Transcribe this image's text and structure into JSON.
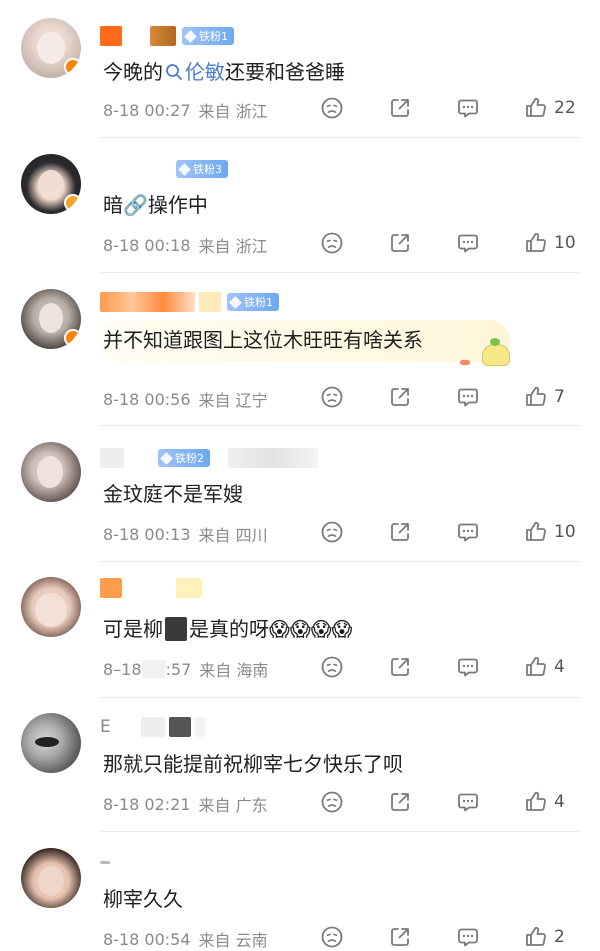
{
  "comments": [
    {
      "text_before": "今晚的",
      "topic": "伦敏",
      "text_after": "还要和爸爸睡",
      "fan_badge": "铁粉1",
      "date": "8-18 00:27",
      "location": "来自 浙江",
      "likes": "22"
    },
    {
      "text": "暗🔗操作中",
      "fan_badge": "铁粉3",
      "date": "8-18 00:18",
      "location": "来自 浙江",
      "likes": "10"
    },
    {
      "text": "并不知道跟图上这位木旺旺有啥关系",
      "fan_badge": "铁粉1",
      "date": "8-18 00:56",
      "location": "来自 辽宁",
      "likes": "7"
    },
    {
      "text": "金玟庭不是军嫂",
      "fan_badge": "铁粉2",
      "date": "8-18 00:13",
      "location": "来自 四川",
      "likes": "10"
    },
    {
      "text_before": "可是柳",
      "text_after": "是真的呀😱😱😱😱",
      "date_before": "8–18",
      "date_after": ":57",
      "location": "来自 海南",
      "likes": "4"
    },
    {
      "name_initial": "E",
      "text": "那就只能提前祝柳宰七夕快乐了呗",
      "date": "8-18 02:21",
      "location": "来自 广东",
      "likes": "4"
    },
    {
      "text": "柳宰久久",
      "date": "8-18 00:54",
      "location": "来自 云南",
      "likes": "2"
    }
  ]
}
